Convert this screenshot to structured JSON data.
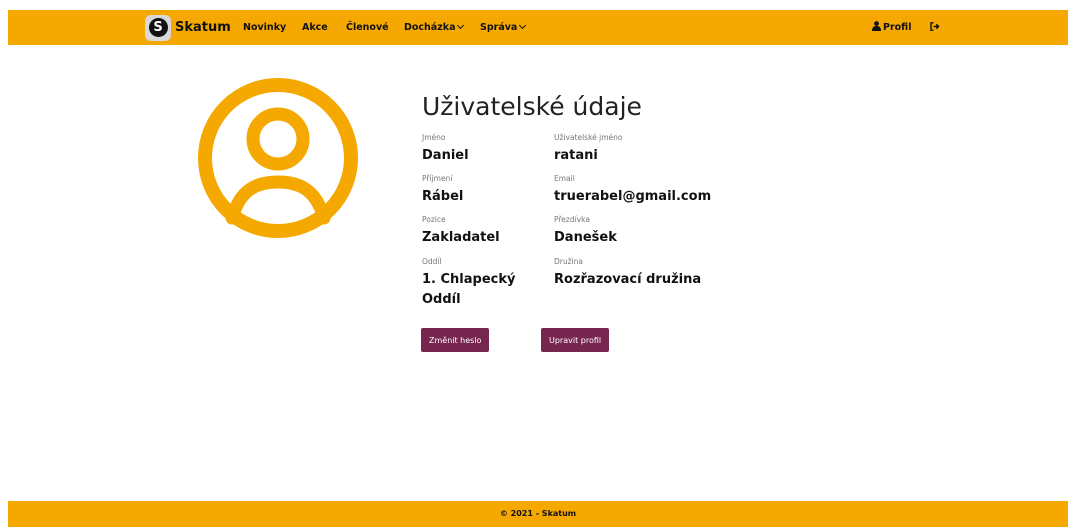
{
  "navbar": {
    "brand_name": "Skatum",
    "brand_logo_letter": "S",
    "items": [
      {
        "label": "Novinky"
      },
      {
        "label": "Akce"
      },
      {
        "label": "Členové"
      },
      {
        "label": "Docházka",
        "dropdown": true
      },
      {
        "label": "Správa",
        "dropdown": true
      }
    ],
    "profile_label": "Profil",
    "profile_icon": "user-icon",
    "logout_icon": "sign-out-icon"
  },
  "avatar_icon": "user-circle-icon",
  "profile": {
    "title": "Uživatelské údaje",
    "fields": [
      {
        "label": "Jméno",
        "value": "Daniel"
      },
      {
        "label": "Uživatelské jméno",
        "value": "ratani"
      },
      {
        "label": "Příjmení",
        "value": "Rábel"
      },
      {
        "label": "Email",
        "value": "truerabel@gmail.com"
      },
      {
        "label": "Pozice",
        "value": "Zakladatel"
      },
      {
        "label": "Přezdívka",
        "value": "Danešek"
      },
      {
        "label": "Oddíl",
        "value": "1. Chlapecký Oddíl"
      },
      {
        "label": "Družina",
        "value": "Rozřazovací družina"
      }
    ],
    "change_password_label": "Změnit heslo",
    "edit_profile_label": "Upravit profil"
  },
  "footer": {
    "text": "© 2021 - Skatum"
  },
  "colors": {
    "accent": "#f5a800",
    "button": "#76264f"
  }
}
